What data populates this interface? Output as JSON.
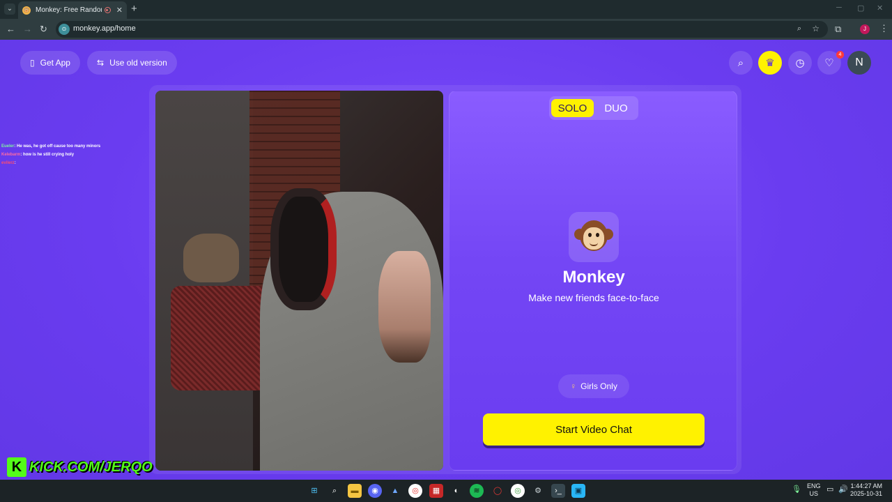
{
  "browser": {
    "tab_title": "Monkey: Free Random Vide",
    "url": "monkey.app/home",
    "profile_initial": "J",
    "new_tab": "+",
    "close": "✕"
  },
  "header": {
    "get_app_label": "Get App",
    "old_version_label": "Use old version",
    "avatar_initial": "N",
    "chat_badge_count": "4"
  },
  "mode": {
    "solo_label": "SOLO",
    "duo_label": "DUO",
    "selected": "SOLO"
  },
  "brand": {
    "name": "Monkey",
    "tagline": "Make new friends face-to-face"
  },
  "filter": {
    "girls_only_label": "Girls Only"
  },
  "cta": {
    "start_label": "Start Video Chat"
  },
  "overlay": {
    "chat": [
      {
        "user": "Eueler",
        "text": ": He was, he got off cause too many minors"
      },
      {
        "user": "Kelebarm",
        "text": ": how is he still crying holy"
      },
      {
        "user": "evilerz",
        "text": ":"
      }
    ],
    "kick_letter": "K",
    "kick_text": "KICK.COM/JERQO"
  },
  "taskbar": {
    "lang_line1": "ENG",
    "lang_line2": "US",
    "time": "1:44:27 AM",
    "date": "2025-10-31"
  },
  "colors": {
    "page_bg": "#6a3cf0",
    "accent_yellow": "#fff200",
    "kick_green": "#53fc18"
  }
}
